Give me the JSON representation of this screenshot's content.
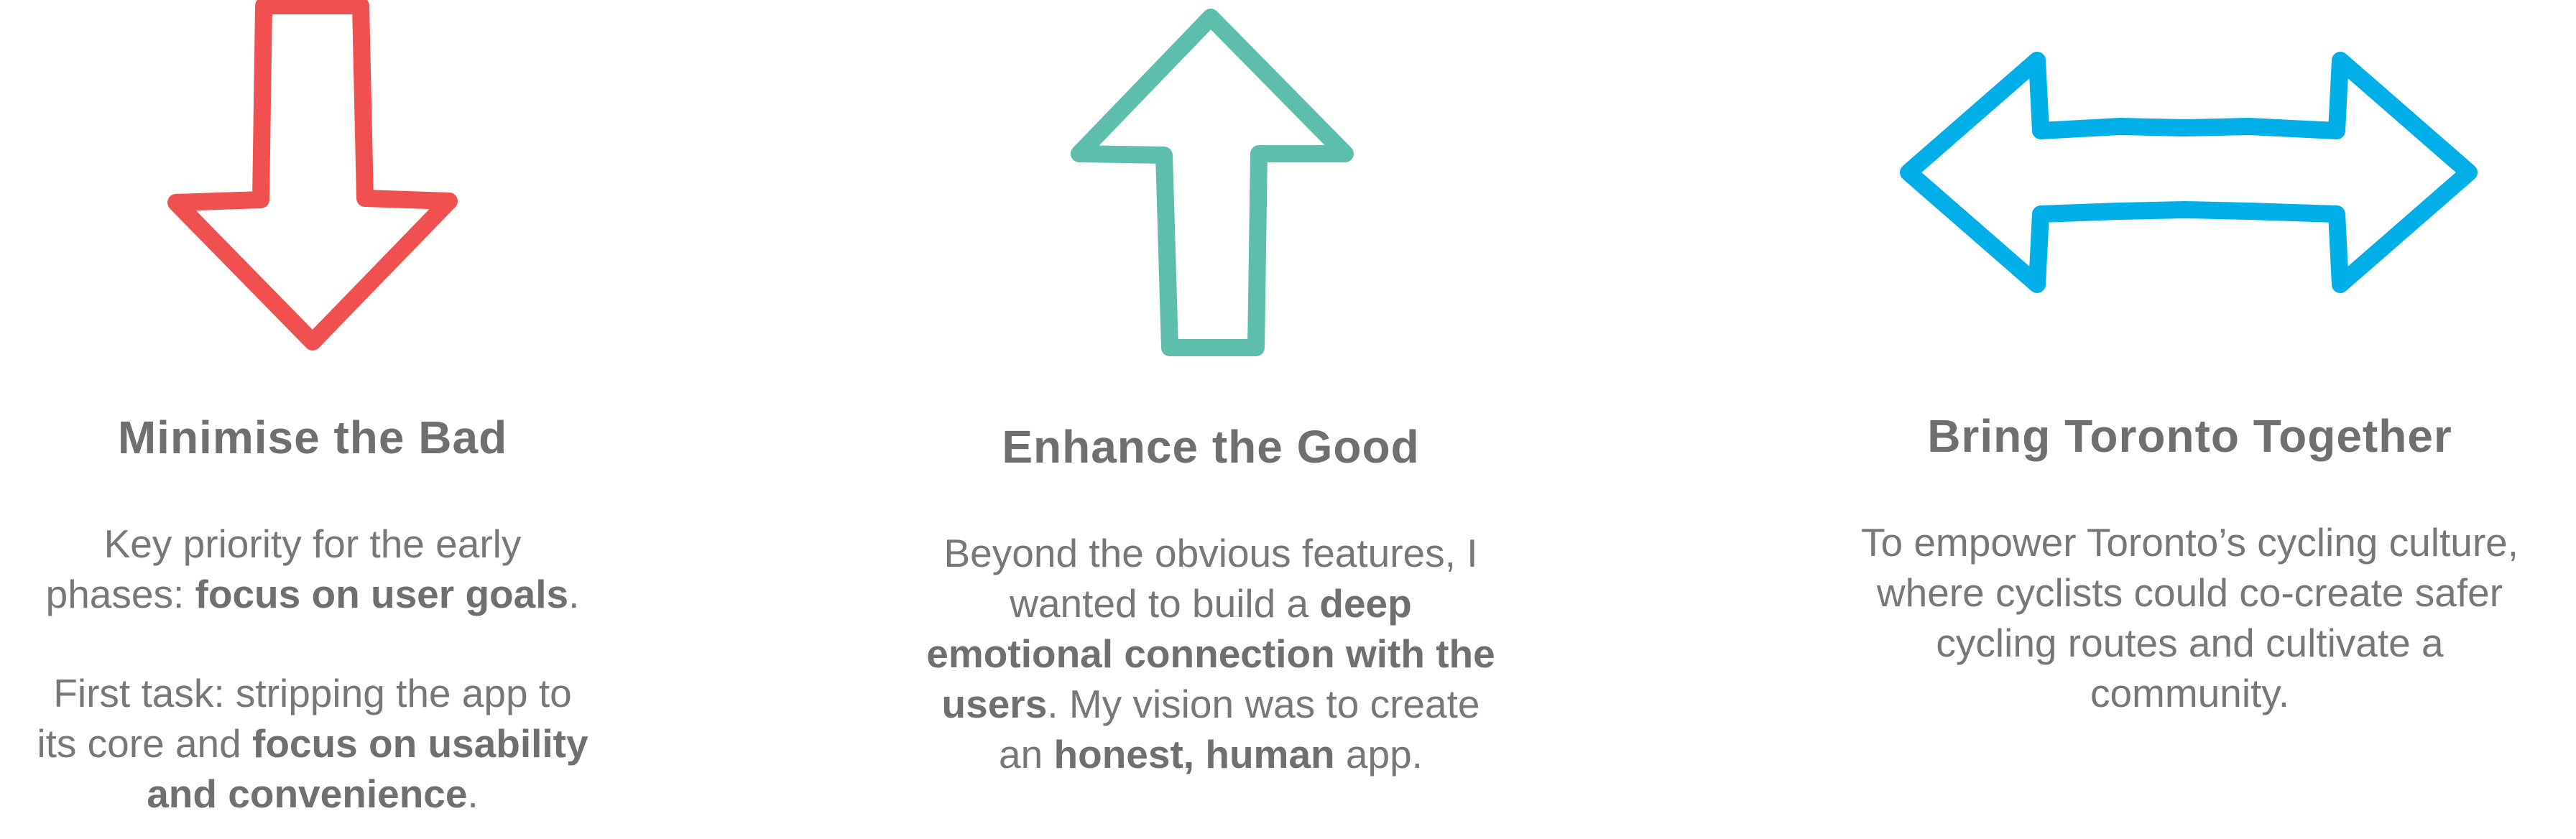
{
  "colors": {
    "red_arrow": "#f05050",
    "teal_arrow": "#5dbfab",
    "blue_arrow": "#00aee8",
    "text": "#777777"
  },
  "columns": [
    {
      "icon": "down-arrow-icon",
      "title": "Minimise the Bad",
      "p1": {
        "t1": "Key priority for the early",
        "t2": "phases:  ",
        "b1": "focus on user goals",
        "t3": "."
      },
      "p2": {
        "t1": "First task: stripping the app to",
        "t2": "its core and ",
        "b1": "focus on usability",
        "b2": "and convenience",
        "t3": "."
      }
    },
    {
      "icon": "up-arrow-icon",
      "title": "Enhance the Good",
      "p1": {
        "t1": "Beyond the obvious features, I",
        "t2": "wanted to build a ",
        "b1": "deep",
        "b2": "emotional connection with the",
        "b3": "users",
        "t3": ". My vision was to create",
        "t4": "an ",
        "b4": "honest, human",
        "t5": " app."
      }
    },
    {
      "icon": "double-arrow-icon",
      "title": "Bring Toronto Together",
      "p1": {
        "l1": "To empower Toronto’s cycling culture,",
        "l2": "where cyclists could co-create safer",
        "l3": "cycling routes and cultivate a",
        "l4": "community."
      }
    }
  ]
}
